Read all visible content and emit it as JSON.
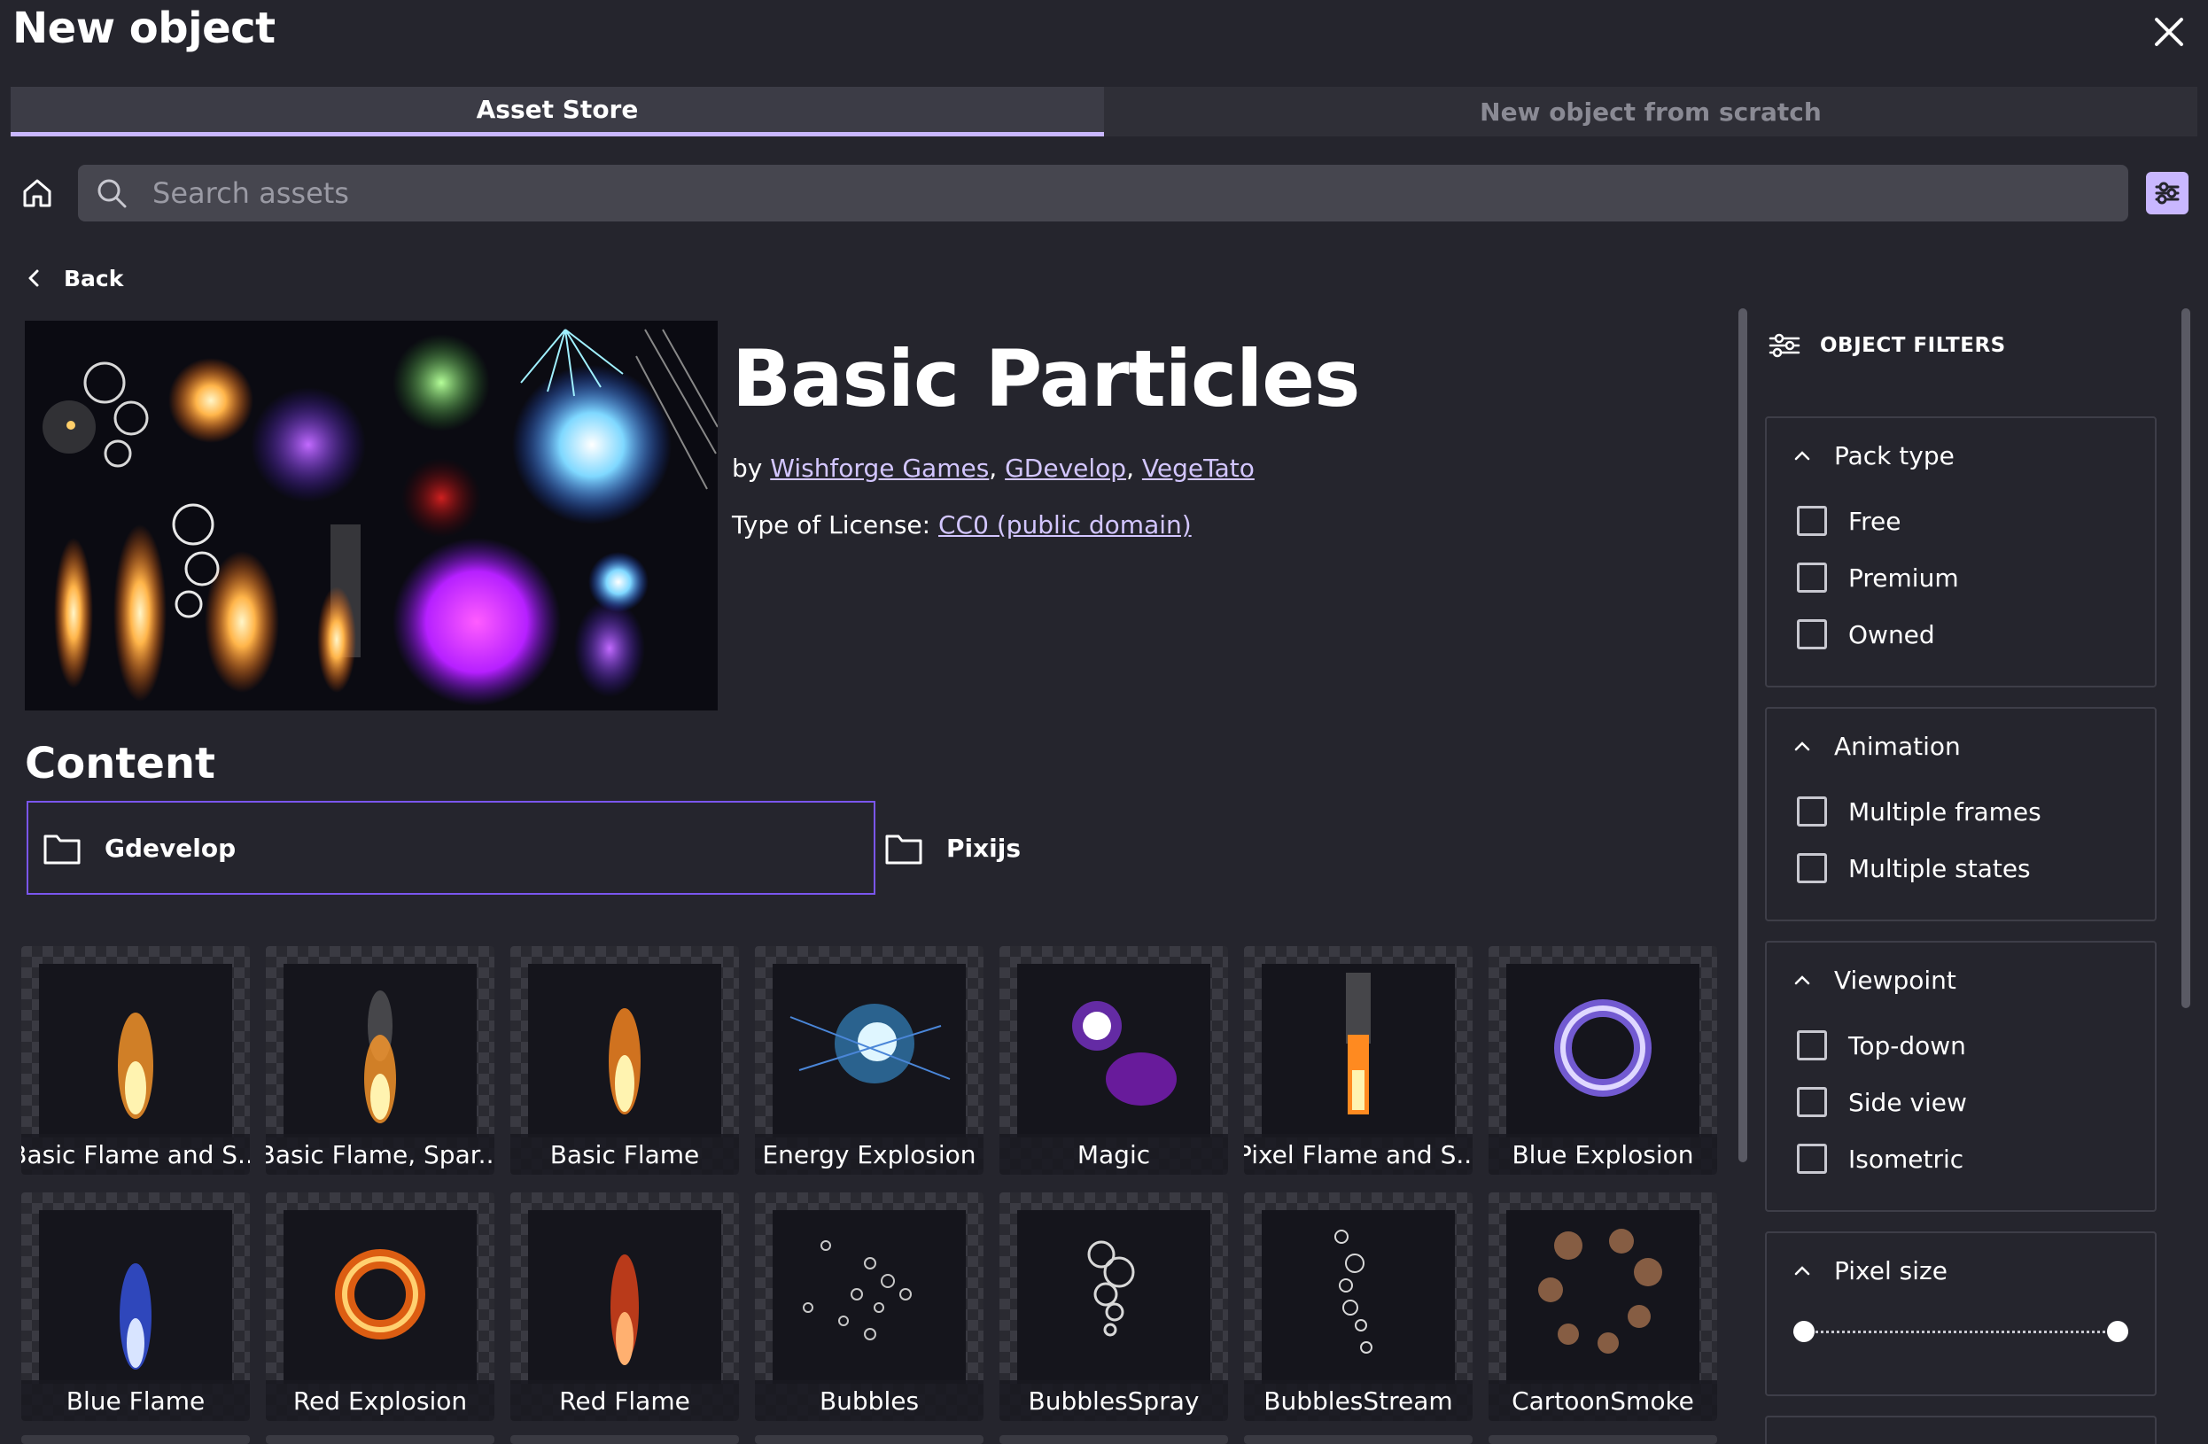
{
  "dialog": {
    "title": "New object"
  },
  "tabs": [
    {
      "label": "Asset Store",
      "active": true
    },
    {
      "label": "New object from scratch",
      "active": false
    }
  ],
  "search": {
    "placeholder": "Search assets",
    "value": ""
  },
  "nav": {
    "back_label": "Back"
  },
  "pack": {
    "title": "Basic Particles",
    "by_prefix": "by ",
    "authors": [
      "Wishforge Games",
      "GDevelop",
      "VegeTato"
    ],
    "license_prefix": "Type of License: ",
    "license": "CC0 (public domain)"
  },
  "content": {
    "heading": "Content",
    "folders": [
      {
        "label": "Gdevelop",
        "selected": true
      },
      {
        "label": "Pixijs",
        "selected": false
      }
    ]
  },
  "assets": [
    {
      "label": "Basic Flame and S...",
      "icon": "orange-flame-sparks"
    },
    {
      "label": "Basic Flame, Spar...",
      "icon": "flame-sparks-smoke"
    },
    {
      "label": "Basic Flame",
      "icon": "orange-flame"
    },
    {
      "label": "Energy Explosion",
      "icon": "blue-energy-burst"
    },
    {
      "label": "Magic",
      "icon": "purple-magic"
    },
    {
      "label": "Pixel Flame and S...",
      "icon": "pixel-flame-smoke"
    },
    {
      "label": "Blue Explosion",
      "icon": "blue-ring-explosion"
    },
    {
      "label": "Blue Flame",
      "icon": "blue-flame"
    },
    {
      "label": "Red Explosion",
      "icon": "red-ring-explosion"
    },
    {
      "label": "Red Flame",
      "icon": "red-flame"
    },
    {
      "label": "Bubbles",
      "icon": "bubbles"
    },
    {
      "label": "BubblesSpray",
      "icon": "bubbles-spray"
    },
    {
      "label": "BubblesStream",
      "icon": "bubbles-stream"
    },
    {
      "label": "CartoonSmoke",
      "icon": "cartoon-smoke"
    }
  ],
  "filters": {
    "title": "OBJECT FILTERS",
    "groups": [
      {
        "name": "Pack type",
        "options": [
          "Free",
          "Premium",
          "Owned"
        ]
      },
      {
        "name": "Animation",
        "options": [
          "Multiple frames",
          "Multiple states"
        ]
      },
      {
        "name": "Viewpoint",
        "options": [
          "Top-down",
          "Side view",
          "Isometric"
        ]
      },
      {
        "name": "Pixel size",
        "range": [
          0,
          1
        ]
      }
    ]
  },
  "colors": {
    "accent": "#c9b7ff",
    "selection_border": "#7a56ee",
    "background": "#25252d"
  }
}
